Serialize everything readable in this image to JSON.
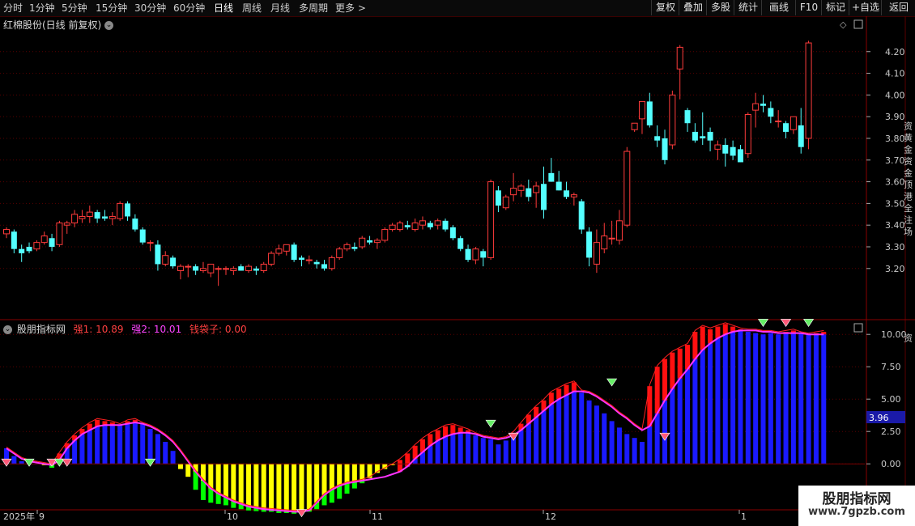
{
  "toolbar": {
    "tabs": [
      "分时",
      "1分钟",
      "5分钟",
      "15分钟",
      "30分钟",
      "60分钟",
      "日线",
      "周线",
      "月线",
      "多周期",
      "更多 >"
    ],
    "active_tab": "日线",
    "right_buttons": [
      "复权",
      "叠加",
      "多股",
      "统计",
      "画线",
      "F10",
      "标记",
      "+自选",
      "返回"
    ]
  },
  "main_chart": {
    "title": "红棉股份(日线 前复权)",
    "axis_labels": [
      "4.20",
      "4.10",
      "4.00",
      "3.90",
      "3.80",
      "3.70",
      "3.60",
      "3.50",
      "3.40",
      "3.30",
      "3.20"
    ],
    "side_strip_text": "资 黄 金 资 金 顶 港 全 注 场"
  },
  "indicator": {
    "name": "股朋指标网",
    "s1_label": "强1: 10.89",
    "s2_label": "强2: 10.01",
    "bag_label": "钱袋子: 0.00",
    "axis_labels": [
      "10.00",
      "7.50",
      "5.00",
      "2.50",
      "0.00"
    ],
    "current_value": "3.96",
    "side_strip_text": "资"
  },
  "time_axis": {
    "labels": [
      "2025年",
      "9",
      "10",
      "11",
      "12",
      "1"
    ]
  },
  "watermark": {
    "title": "股朋指标网",
    "url": "www.7gpzb.com"
  },
  "colors": {
    "up": "#ff3b3b",
    "down": "#54ffff",
    "bar_blue": "#1a1aff",
    "bar_red": "#ff1010",
    "bar_yellow": "#ffff00",
    "bar_green": "#00ff00",
    "line_magenta": "#ff33ff",
    "line_red": "#ff2020",
    "grid": "#5a0000",
    "axis_text": "#c8c8c8"
  },
  "chart_data": {
    "type": "candlestick",
    "price_axis": {
      "ylim": [
        3.05,
        4.27
      ],
      "ticks": [
        3.2,
        3.3,
        3.4,
        3.5,
        3.6,
        3.7,
        3.8,
        3.9,
        4.0,
        4.1,
        4.2
      ]
    },
    "candles": [
      [
        3.36,
        3.39,
        3.34,
        3.38
      ],
      [
        3.37,
        3.38,
        3.27,
        3.29
      ],
      [
        3.29,
        3.31,
        3.23,
        3.27
      ],
      [
        3.3,
        3.32,
        3.27,
        3.28
      ],
      [
        3.29,
        3.33,
        3.28,
        3.32
      ],
      [
        3.32,
        3.37,
        3.31,
        3.35
      ],
      [
        3.34,
        3.36,
        3.28,
        3.3
      ],
      [
        3.31,
        3.42,
        3.3,
        3.41
      ],
      [
        3.4,
        3.42,
        3.36,
        3.41
      ],
      [
        3.41,
        3.47,
        3.39,
        3.45
      ],
      [
        3.43,
        3.47,
        3.41,
        3.44
      ],
      [
        3.44,
        3.49,
        3.41,
        3.46
      ],
      [
        3.46,
        3.47,
        3.41,
        3.43
      ],
      [
        3.44,
        3.47,
        3.42,
        3.43
      ],
      [
        3.43,
        3.46,
        3.4,
        3.44
      ],
      [
        3.43,
        3.51,
        3.42,
        3.5
      ],
      [
        3.5,
        3.51,
        3.42,
        3.44
      ],
      [
        3.43,
        3.45,
        3.37,
        3.38
      ],
      [
        3.38,
        3.39,
        3.31,
        3.32
      ],
      [
        3.32,
        3.33,
        3.28,
        3.32
      ],
      [
        3.31,
        3.33,
        3.19,
        3.22
      ],
      [
        3.22,
        3.28,
        3.21,
        3.26
      ],
      [
        3.25,
        3.26,
        3.2,
        3.21
      ],
      [
        3.19,
        3.22,
        3.15,
        3.21
      ],
      [
        3.21,
        3.22,
        3.16,
        3.21
      ],
      [
        3.21,
        3.22,
        3.17,
        3.19
      ],
      [
        3.19,
        3.23,
        3.18,
        3.2
      ],
      [
        3.18,
        3.21,
        3.16,
        3.22
      ],
      [
        3.2,
        3.21,
        3.12,
        3.2
      ],
      [
        3.2,
        3.21,
        3.17,
        3.2
      ],
      [
        3.19,
        3.21,
        3.17,
        3.2
      ],
      [
        3.21,
        3.22,
        3.19,
        3.19
      ],
      [
        3.19,
        3.22,
        3.18,
        3.21
      ],
      [
        3.2,
        3.21,
        3.17,
        3.19
      ],
      [
        3.19,
        3.23,
        3.18,
        3.22
      ],
      [
        3.22,
        3.28,
        3.21,
        3.27
      ],
      [
        3.27,
        3.31,
        3.26,
        3.29
      ],
      [
        3.28,
        3.31,
        3.26,
        3.31
      ],
      [
        3.31,
        3.32,
        3.23,
        3.24
      ],
      [
        3.25,
        3.26,
        3.21,
        3.24
      ],
      [
        3.24,
        3.26,
        3.22,
        3.24
      ],
      [
        3.23,
        3.24,
        3.2,
        3.22
      ],
      [
        3.22,
        3.24,
        3.19,
        3.2
      ],
      [
        3.2,
        3.26,
        3.19,
        3.25
      ],
      [
        3.25,
        3.3,
        3.24,
        3.29
      ],
      [
        3.29,
        3.32,
        3.28,
        3.31
      ],
      [
        3.3,
        3.32,
        3.28,
        3.29
      ],
      [
        3.3,
        3.35,
        3.29,
        3.34
      ],
      [
        3.33,
        3.35,
        3.31,
        3.32
      ],
      [
        3.32,
        3.34,
        3.29,
        3.33
      ],
      [
        3.33,
        3.39,
        3.32,
        3.38
      ],
      [
        3.38,
        3.41,
        3.37,
        3.4
      ],
      [
        3.38,
        3.42,
        3.37,
        3.41
      ],
      [
        3.4,
        3.42,
        3.38,
        3.39
      ],
      [
        3.38,
        3.43,
        3.37,
        3.41
      ],
      [
        3.4,
        3.44,
        3.38,
        3.42
      ],
      [
        3.41,
        3.42,
        3.38,
        3.39
      ],
      [
        3.4,
        3.43,
        3.38,
        3.42
      ],
      [
        3.42,
        3.43,
        3.37,
        3.38
      ],
      [
        3.39,
        3.4,
        3.33,
        3.34
      ],
      [
        3.34,
        3.35,
        3.28,
        3.29
      ],
      [
        3.29,
        3.31,
        3.23,
        3.24
      ],
      [
        3.24,
        3.3,
        3.22,
        3.29
      ],
      [
        3.28,
        3.29,
        3.21,
        3.25
      ],
      [
        3.25,
        3.61,
        3.24,
        3.6
      ],
      [
        3.56,
        3.58,
        3.46,
        3.49
      ],
      [
        3.48,
        3.54,
        3.47,
        3.53
      ],
      [
        3.54,
        3.64,
        3.51,
        3.57
      ],
      [
        3.56,
        3.59,
        3.53,
        3.58
      ],
      [
        3.57,
        3.61,
        3.51,
        3.53
      ],
      [
        3.55,
        3.6,
        3.48,
        3.58
      ],
      [
        3.59,
        3.67,
        3.43,
        3.47
      ],
      [
        3.64,
        3.71,
        3.6,
        3.6
      ],
      [
        3.6,
        3.65,
        3.56,
        3.56
      ],
      [
        3.56,
        3.6,
        3.52,
        3.53
      ],
      [
        3.53,
        3.55,
        3.49,
        3.54
      ],
      [
        3.51,
        3.52,
        3.36,
        3.38
      ],
      [
        3.37,
        3.39,
        3.21,
        3.25
      ],
      [
        3.22,
        3.38,
        3.18,
        3.32
      ],
      [
        3.29,
        3.41,
        3.27,
        3.35
      ],
      [
        3.34,
        3.42,
        3.31,
        3.34
      ],
      [
        3.33,
        3.47,
        3.31,
        3.42
      ],
      [
        3.4,
        3.76,
        3.39,
        3.74
      ],
      [
        3.84,
        3.87,
        3.83,
        3.87
      ],
      [
        3.89,
        3.93,
        3.82,
        3.97
      ],
      [
        3.97,
        4.01,
        3.85,
        3.86
      ],
      [
        3.81,
        3.86,
        3.76,
        3.79
      ],
      [
        3.8,
        3.84,
        3.68,
        3.7
      ],
      [
        3.77,
        4.02,
        3.75,
        4.0
      ],
      [
        4.12,
        4.23,
        3.98,
        4.22
      ],
      [
        3.93,
        3.94,
        3.83,
        3.87
      ],
      [
        3.83,
        3.87,
        3.78,
        3.79
      ],
      [
        3.81,
        3.92,
        3.77,
        3.8
      ],
      [
        3.83,
        3.85,
        3.74,
        3.79
      ],
      [
        3.75,
        3.79,
        3.7,
        3.77
      ],
      [
        3.77,
        3.8,
        3.67,
        3.73
      ],
      [
        3.76,
        3.79,
        3.7,
        3.72
      ],
      [
        3.75,
        3.77,
        3.69,
        3.69
      ],
      [
        3.73,
        3.92,
        3.71,
        3.91
      ],
      [
        3.93,
        4.01,
        3.85,
        3.96
      ],
      [
        3.96,
        4.0,
        3.92,
        3.95
      ],
      [
        3.94,
        3.97,
        3.87,
        3.9
      ],
      [
        3.88,
        3.93,
        3.85,
        3.88
      ],
      [
        3.87,
        3.88,
        3.8,
        3.83
      ],
      [
        3.84,
        3.89,
        3.82,
        3.9
      ],
      [
        3.86,
        3.94,
        3.73,
        3.76
      ],
      [
        3.8,
        4.25,
        3.75,
        4.24
      ]
    ],
    "indicator_axis": {
      "ylim": [
        -3.05,
        10.2
      ],
      "ticks": [
        0,
        2.5,
        5,
        7.5,
        10
      ]
    },
    "indicator_bars": [
      1.2,
      0.6,
      0.2,
      0.1,
      0.0,
      -0.1,
      -0.3,
      0.8,
      1.6,
      2.2,
      2.7,
      3.1,
      3.4,
      3.3,
      3.2,
      3.0,
      3.3,
      3.4,
      3.1,
      2.7,
      2.3,
      1.7,
      1.0,
      -0.4,
      -1.0,
      -2.0,
      -2.8,
      -3.0,
      -3.1,
      -3.2,
      -3.4,
      -3.5,
      -3.6,
      -3.65,
      -3.7,
      -3.7,
      -3.8,
      -3.8,
      -3.85,
      -3.8,
      -3.7,
      -3.5,
      -3.2,
      -3.0,
      -2.7,
      -2.3,
      -1.9,
      -1.5,
      -1.1,
      -0.7,
      -0.4,
      -0.1,
      0.3,
      0.8,
      1.4,
      1.9,
      2.3,
      2.6,
      2.9,
      3.0,
      2.8,
      2.6,
      2.2,
      2.0,
      1.9,
      1.5,
      1.8,
      2.4,
      3.1,
      3.8,
      4.4,
      4.9,
      5.5,
      5.8,
      6.1,
      6.3,
      5.5,
      4.9,
      4.5,
      3.9,
      3.3,
      2.8,
      2.3,
      2.0,
      1.7,
      6.0,
      7.5,
      8.1,
      8.6,
      8.9,
      9.2,
      10.2,
      10.6,
      10.4,
      10.6,
      10.8,
      10.6,
      10.4,
      10.2,
      10.1,
      10.0,
      10.1,
      10.0,
      10.2,
      10.3,
      10.1,
      10.0,
      10.1,
      10.2
    ],
    "line_strong1": [
      1.2,
      0.8,
      0.4,
      0.2,
      0.1,
      0.0,
      -0.1,
      0.3,
      1.2,
      1.8,
      2.3,
      2.6,
      2.9,
      3.0,
      3.0,
      3.0,
      3.1,
      3.2,
      3.1,
      2.9,
      2.6,
      2.2,
      1.7,
      1.0,
      0.2,
      -0.6,
      -1.3,
      -1.9,
      -2.3,
      -2.6,
      -2.9,
      -3.1,
      -3.3,
      -3.4,
      -3.5,
      -3.55,
      -3.6,
      -3.65,
      -3.7,
      -3.7,
      -3.6,
      -3.0,
      -2.4,
      -2.0,
      -1.7,
      -1.5,
      -1.4,
      -1.3,
      -1.2,
      -1.1,
      -1.0,
      -0.8,
      -0.6,
      -0.2,
      0.4,
      0.9,
      1.4,
      1.8,
      2.1,
      2.3,
      2.4,
      2.4,
      2.3,
      2.1,
      2.0,
      1.9,
      2.0,
      2.2,
      2.6,
      3.1,
      3.6,
      4.1,
      4.6,
      5.0,
      5.3,
      5.6,
      5.6,
      5.5,
      5.2,
      4.8,
      4.4,
      3.9,
      3.5,
      3.0,
      2.6,
      2.9,
      3.9,
      4.9,
      5.8,
      6.6,
      7.3,
      8.1,
      8.8,
      9.3,
      9.7,
      10.0,
      10.2,
      10.3,
      10.3,
      10.3,
      10.2,
      10.2,
      10.1,
      10.1,
      10.1,
      10.1,
      10.0,
      10.0,
      10.0
    ]
  }
}
